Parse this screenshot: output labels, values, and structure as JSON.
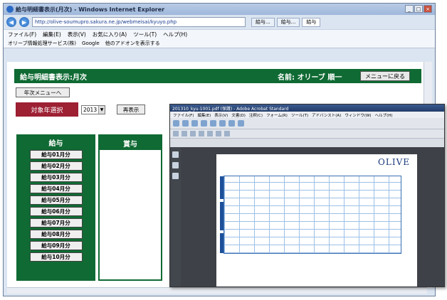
{
  "browser": {
    "title": "給与明細書表示(月次) - Windows Internet Explorer",
    "address": "http://olive-soumupro.sakura.ne.jp/webmeisai/kyuyo.php",
    "tabs": [
      "給与...",
      "給与...",
      "給与"
    ],
    "menu": [
      "ファイル(F)",
      "編集(E)",
      "表示(V)",
      "お気に入り(A)",
      "ツール(T)",
      "ヘルプ(H)"
    ],
    "favorites": [
      "オリーブ情報処理サービス(株)",
      "Google",
      "他のアドオンを表示する"
    ]
  },
  "page": {
    "title": "給与明細書表示:月次",
    "user_name": "名前: オリーブ 順一",
    "back_menu_label": "メニューに戻る",
    "year_menu_label": "年次メニューへ",
    "year_select_label": "対象年選択",
    "year_value": "2013",
    "show_label": "再表示"
  },
  "salary": {
    "heading": "給与",
    "months": [
      "給与01月分",
      "給与02月分",
      "給与03月分",
      "給与04月分",
      "給与05月分",
      "給与06月分",
      "給与07月分",
      "給与08月分",
      "給与09月分",
      "給与10月分"
    ]
  },
  "bonus": {
    "heading": "賞与"
  },
  "pdf": {
    "title": "201310_kyu-1001.pdf (保護) - Adobe Acrobat Standard",
    "menu": [
      "ファイル(F)",
      "編集(E)",
      "表示(V)",
      "文書(D)",
      "注釈(C)",
      "フォーム(R)",
      "ツール(T)",
      "アドバンスト(A)",
      "ウィンドウ(W)",
      "ヘルプ(H)"
    ],
    "logo": "OLIVE"
  }
}
